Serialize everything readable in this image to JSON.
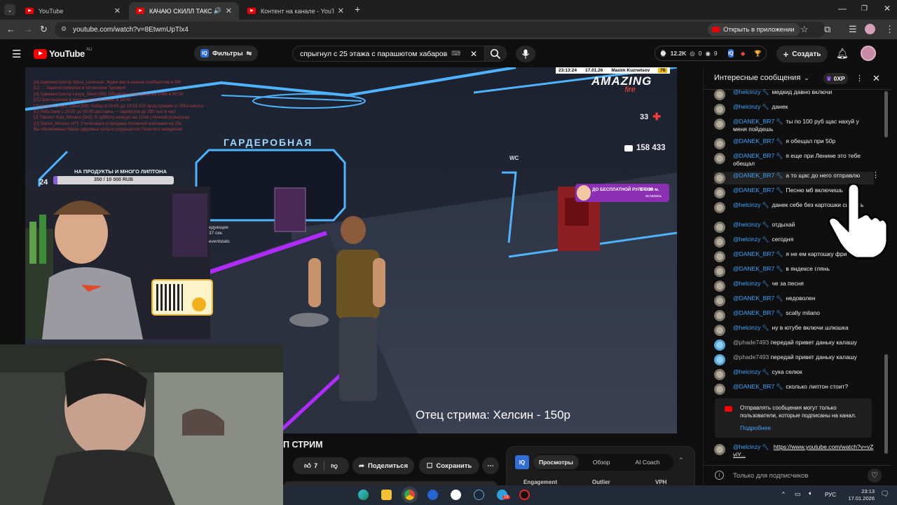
{
  "browser": {
    "tabs": [
      {
        "title": "YouTube"
      },
      {
        "title": "КАЧАЮ СКИЛЛ ТАКСИСТА"
      },
      {
        "title": "Контент на канале - YouTube S"
      }
    ],
    "url": "youtube.com/watch?v=8EtwmUpTlx4",
    "open_in_app": "Открыть в приложении"
  },
  "youtube": {
    "logo_text": "YouTube",
    "region": "AU",
    "filters_label": "Фильтры",
    "search_query": "спрыгнул с 25 этажа с парашютом хабаров",
    "stats": {
      "views": "12.2K",
      "comments": "0",
      "likes": "9"
    },
    "create_label": "Создать"
  },
  "video": {
    "overlay_time": "23:13:24",
    "overlay_date": "17.01.26",
    "overlay_player": "Maxim Kuznetsov",
    "overlay_id": "76",
    "game_logo_1": "AMAZING",
    "game_logo_2": "fire",
    "health": "33",
    "money": "158 433",
    "sign_wardrobe": "ГАРДЕРОБНАЯ",
    "sign_wc": "WC",
    "goal_title": "НА ПРОДУКТЫ И МНОГО ЛИПТОНА",
    "goal_progress_text": "350 / 10 000 RUB",
    "goal_progress": 0.035,
    "goal_counter": "24",
    "roulette_title": "ДО БЕСПЛАТНОЙ РУЛЕТКИ",
    "roulette_time": "3 ч. 28 м.",
    "roulette_sub": "осталось",
    "next_label": "едующее",
    "next_time": "37 сек.",
    "events_label": "eventstats",
    "subtitle": "Отец стрима: Хелсин - 150р",
    "chat_log": [
      "[A] Администратор Spica_Leveraux: Ждём вас в нашем сообществе в ВК!",
      "[C] ...: Зарегистрируйся в пятничном Турнире!",
      "[A] Администратор Lesya_Silent [59]: Объявлен розыгрыш на 10КК в 00:00",
      "[C] Приглашение в еженедельный ивент в 16:00",
      "[J] Цесист Lesya_Silent [59]: Набор в 00:00 до 23:59 100 проц премии от 350к наката",
      "[C] Работаем с 18:00 до 00:00 доставка — заработок до 350 тыс в час!",
      "[J] Таксист Kiwi_Morano [342]: В субботу конкурс на 110кк | Ночной розыгрыш",
      "[C] Daniel_Morano [47]: Утилизация и продажа поливной компании на 25к",
      "Вы обезвожены! Ваше здоровье сильно ухудшается! Посетите заведение"
    ]
  },
  "below_video": {
    "title_fragment": "П СТРИМ",
    "likes": "7",
    "share_label": "Поделиться",
    "save_label": "Сохранить",
    "vidiq_tabs": [
      "Просмотры",
      "Обзор",
      "AI Coach"
    ],
    "vidiq_cols": [
      "Engagement",
      "Outlier",
      "VPH"
    ]
  },
  "chat": {
    "header_title": "Интересные сообщения",
    "xp_label": "0XP",
    "messages": [
      {
        "author": "@helcinzy",
        "text": "медкид давно включи",
        "type": "member"
      },
      {
        "author": "@helcinzy",
        "text": "данек",
        "type": "member"
      },
      {
        "author": "@DANEK_BR7",
        "text": "ты по 100 руб щас нахуй у меня пойдешь",
        "type": "member"
      },
      {
        "author": "@DANEK_BR7",
        "text": "я обещал при 50р",
        "type": "member"
      },
      {
        "author": "@DANEK_BR7",
        "text": "я еще при Ленине это тебе обещал",
        "type": "member"
      },
      {
        "author": "@DANEK_BR7",
        "text": "а то щас до него отправлю",
        "type": "member"
      },
      {
        "author": "@DANEK_BR7",
        "text": "Песню мб включишь",
        "type": "member"
      },
      {
        "author": "@helcinzy",
        "text": "данек себе без картошки сидишь",
        "type": "member"
      },
      {
        "author": "@helcinzy",
        "text": "отдыхай",
        "type": "member"
      },
      {
        "author": "@helcinzy",
        "text": "сегодня",
        "type": "member"
      },
      {
        "author": "@DANEK_BR7",
        "text": "я не ем картошку фри",
        "type": "member"
      },
      {
        "author": "@DANEK_BR7",
        "text": "в яндексе глянь",
        "type": "member"
      },
      {
        "author": "@helcinzy",
        "text": "че за песня",
        "type": "member"
      },
      {
        "author": "@DANEK_BR7",
        "text": "недоволен",
        "type": "member"
      },
      {
        "author": "@DANEK_BR7",
        "text": "scally milano",
        "type": "member"
      },
      {
        "author": "@helcinzy",
        "text": "ну в ютубе включи шлюшка",
        "type": "member"
      },
      {
        "author": "@phade7493",
        "text": "передай привет даньку калашу",
        "type": "plain"
      },
      {
        "author": "@phade7493",
        "text": "передай привет даньку калашу",
        "type": "plain"
      },
      {
        "author": "@helcinzy",
        "text": "сука селюк",
        "type": "member"
      },
      {
        "author": "@DANEK_BR7",
        "text": "сколько липтон стоит?",
        "type": "member"
      }
    ],
    "notice_text": "Отправлять сообщения могут только пользователи, которые подписаны на канал.",
    "notice_link": "Подробнее",
    "last_author": "@helcinzy",
    "last_link": "https://www.youtube.com/watch?v=vZviY...",
    "input_placeholder": "Только для подписчиков"
  },
  "taskbar": {
    "lang": "РУС",
    "time": "23:13",
    "date": "17.01.2026",
    "badge": "18"
  },
  "colors": {
    "accent_blue": "#3ea6ff",
    "youtube_red": "#ff0000",
    "neon_blue": "#4fb4ff",
    "neon_purple": "#b02bff"
  }
}
